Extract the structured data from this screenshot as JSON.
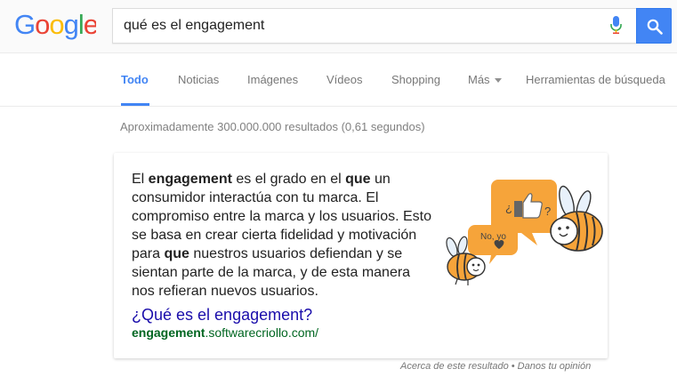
{
  "header": {
    "logo_text": "Google",
    "search_query": "qué es el engagement",
    "mic_icon": "microphone-icon",
    "search_icon": "search-icon",
    "colors": {
      "blue": "#4285f4",
      "red": "#ea4335",
      "yellow": "#fbbc05",
      "green": "#34a853"
    }
  },
  "tabs": {
    "items": [
      "Todo",
      "Noticias",
      "Imágenes",
      "Vídeos",
      "Shopping",
      "Más"
    ],
    "tools": "Herramientas de búsqueda",
    "active": "Todo"
  },
  "stats": "Aproximadamente 300.000.000 resultados (0,61 segundos)",
  "snippet": {
    "p1": "El ",
    "b1": "engagement",
    "p2": " es el grado en el ",
    "b2": "que",
    "p3": " un consumidor interactúa con tu marca. El compromiso entre la marca y los usuarios. Esto se basa en crear cierta fidelidad y motivación para ",
    "b3": "que",
    "p4": " nuestros usuarios defiendan y se sientan parte de la marca, y de esta manera nos refieran nuevos usuarios.",
    "link_title": "¿Qué es el engagement?",
    "url_bold": "engagement",
    "url_rest": ".softwarecriollo.com/",
    "bubble_small_text": "No, yo",
    "bubble_big_q1": "¿",
    "bubble_big_q2": "?"
  },
  "footer": {
    "about": "Acerca de este resultado",
    "separator": " • ",
    "feedback": "Danos tu opinión"
  }
}
